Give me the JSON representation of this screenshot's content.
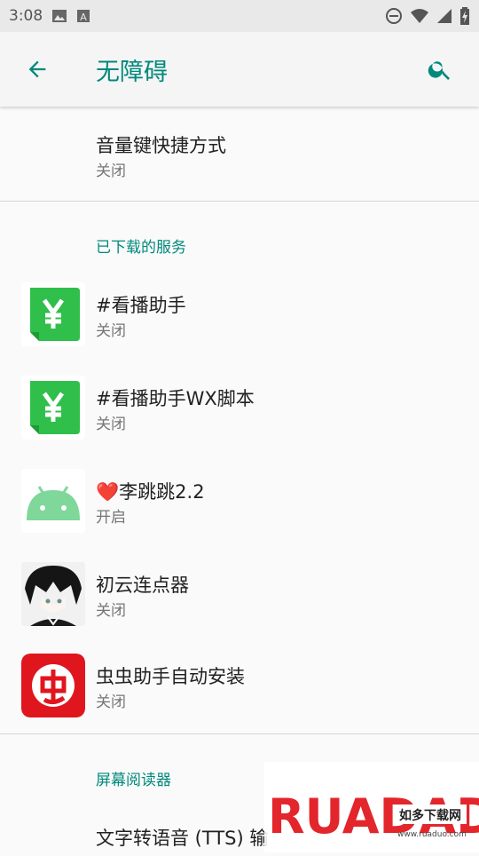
{
  "status_bar": {
    "time": "3:08",
    "icons": [
      "image-icon",
      "text-a-icon",
      "dnd-icon",
      "wifi-icon",
      "signal-icon",
      "battery-icon"
    ]
  },
  "app_bar": {
    "title": "无障碍",
    "back_icon": "arrow-left-icon",
    "search_icon": "search-icon",
    "accent": "#00897b"
  },
  "top_item": {
    "title": "音量键快捷方式",
    "subtitle": "关闭"
  },
  "section_downloaded": "已下载的服务",
  "services": [
    {
      "title": "#看播助手",
      "subtitle": "关闭",
      "icon": "wallet-yen-icon"
    },
    {
      "title": "#看播助手WX脚本",
      "subtitle": "关闭",
      "icon": "wallet-yen-icon"
    },
    {
      "heart": "❤️",
      "title": "李跳跳2.2",
      "subtitle": "开启",
      "icon": "android-icon"
    },
    {
      "title": "初云连点器",
      "subtitle": "关闭",
      "icon": "anime-avatar-icon"
    },
    {
      "title": "虫虫助手自动安装",
      "subtitle": "关闭",
      "icon": "chongchong-icon"
    }
  ],
  "section_screen_reader": "屏幕阅读器",
  "tts_item": {
    "title": "文字转语音 (TTS) 输"
  },
  "watermark": {
    "brand": "RUADADO",
    "sub": "如多下载网",
    "url": "www.ruaduo.com"
  }
}
